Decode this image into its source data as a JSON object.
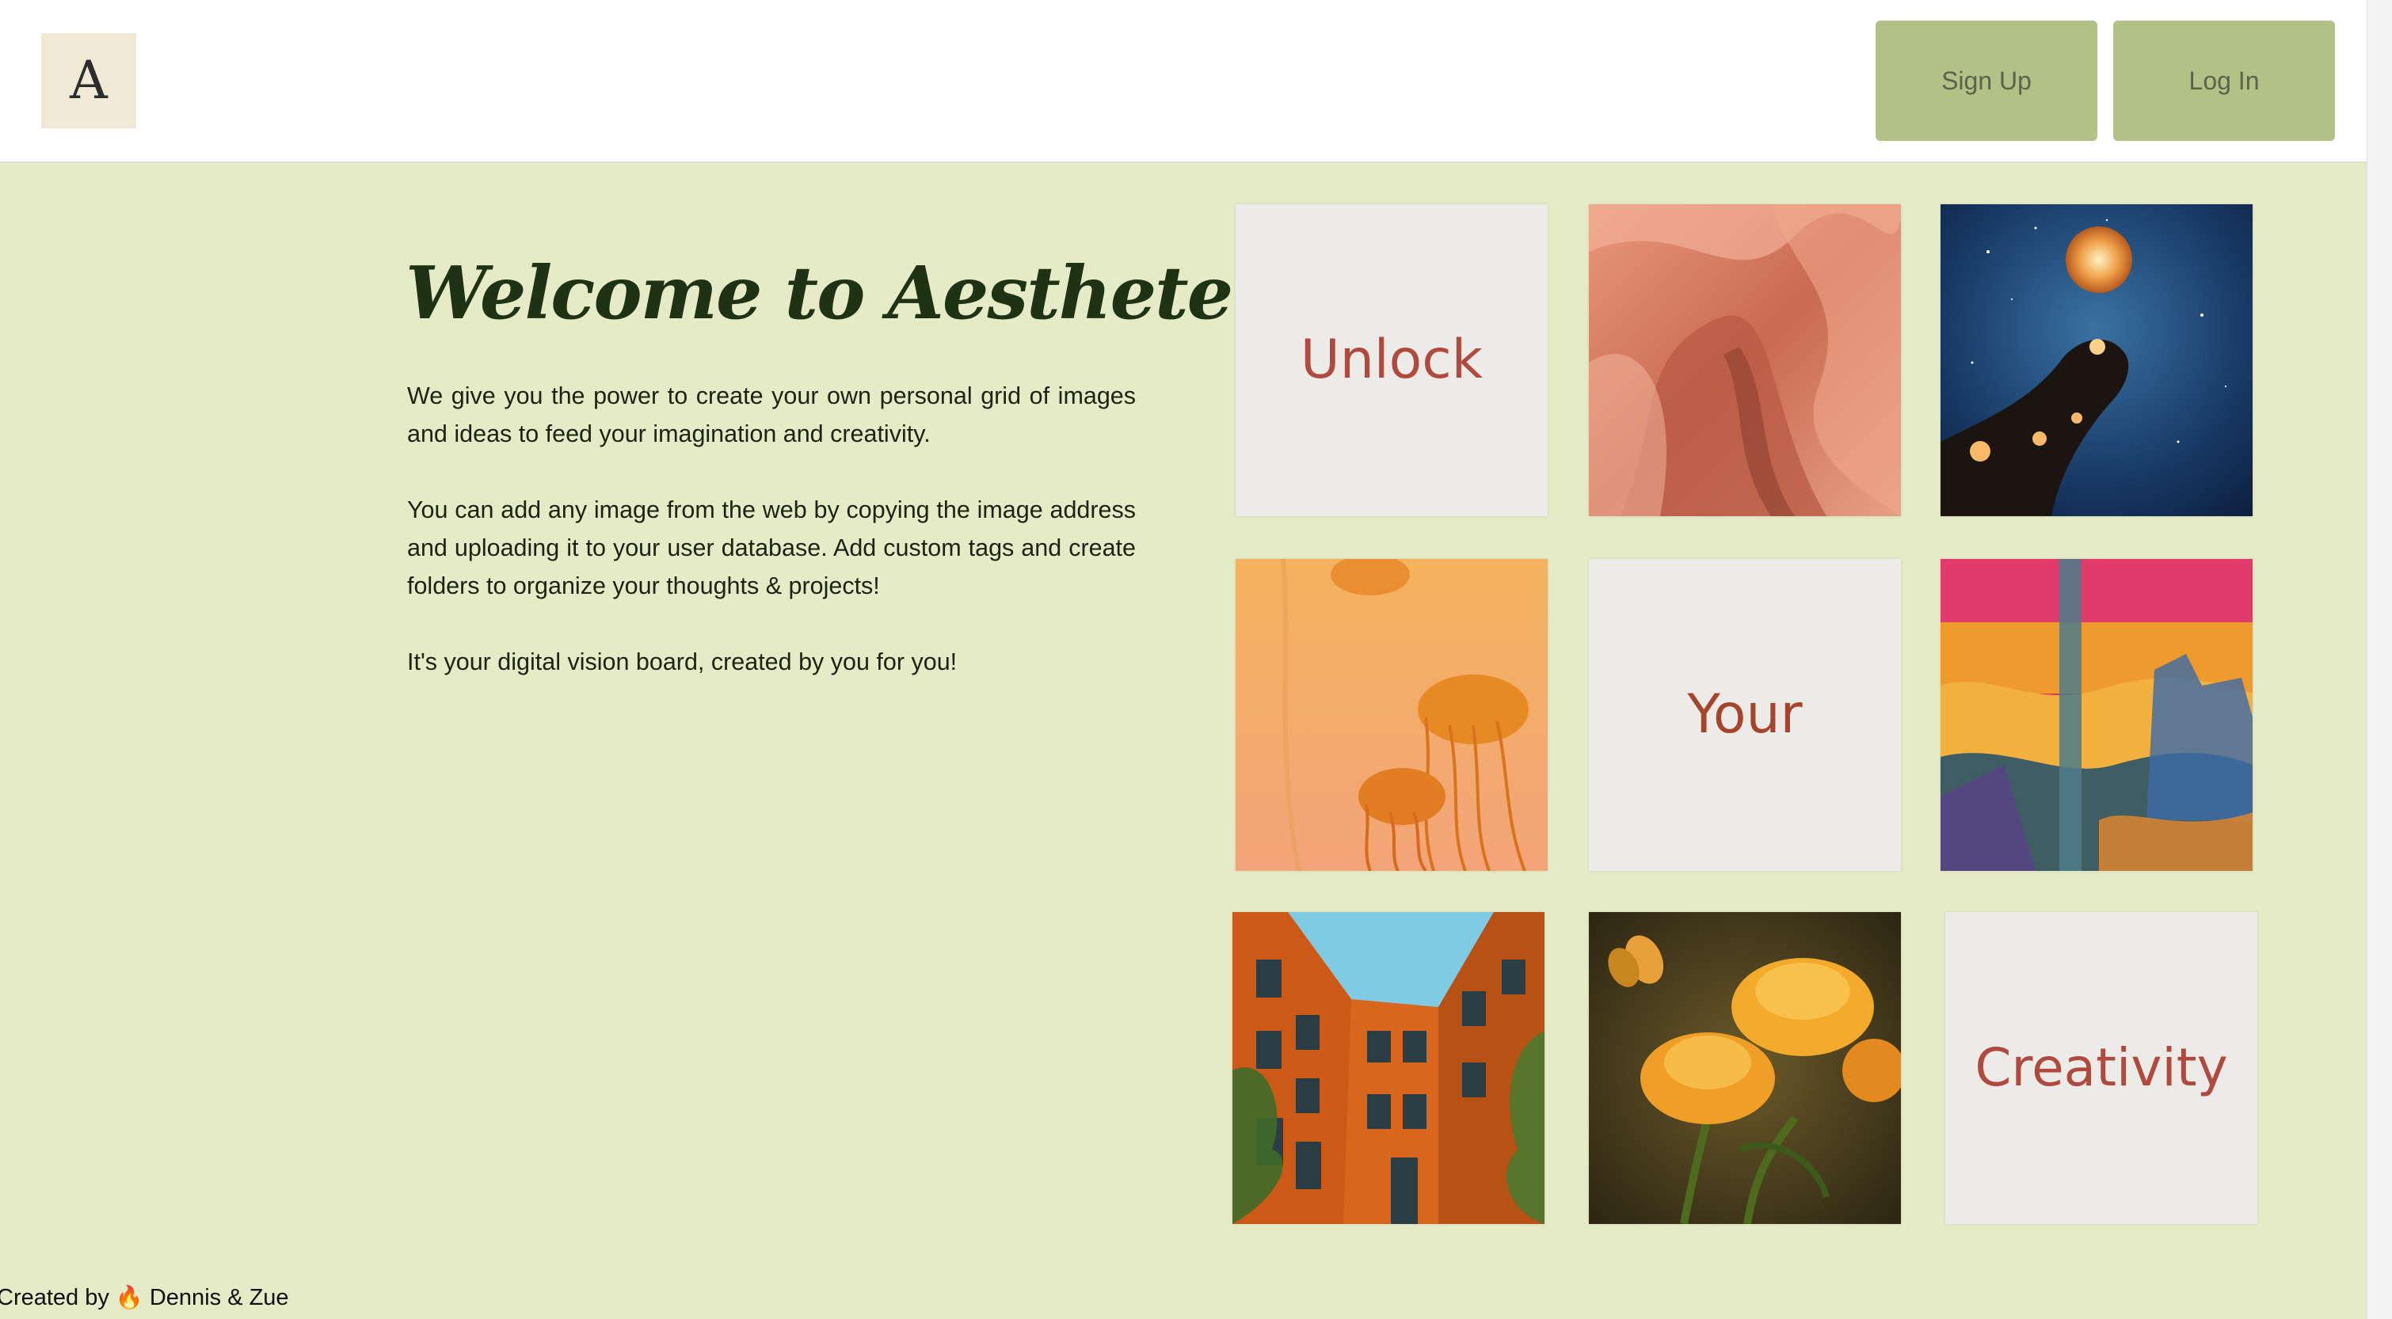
{
  "header": {
    "logo_letter": "A",
    "signup_label": "Sign Up",
    "login_label": "Log In"
  },
  "main": {
    "title": "Welcome to Aesthete !",
    "paragraphs": [
      "We give you the power to create your own personal grid of images and ideas to feed your imagination and creativity.",
      "You can add any image from the web by copying the image address and uploading it to your user database. Add custom tags and create folders to organize your thoughts & projects!",
      "It's your digital vision board, created by you for you!"
    ]
  },
  "grid": {
    "word_tiles": [
      "Unlock",
      "Your",
      "Creativity"
    ],
    "image_tiles": [
      "red-sandstone-canyon-image",
      "hand-holding-glowing-orb-galaxy-image",
      "orange-jellyfish-image",
      "abstract-painted-landscape-image",
      "orange-building-courtyard-image",
      "yellow-flowers-butterfly-image"
    ]
  },
  "footer": {
    "prefix": "Created by",
    "flame_icon": "🔥",
    "authors": "Dennis & Zue"
  },
  "colors": {
    "header_bg": "#ffffff",
    "main_bg": "#e5eac7",
    "button_bg": "#b2c185",
    "title_color": "#1f3314",
    "word_color": "#b04a3e"
  }
}
